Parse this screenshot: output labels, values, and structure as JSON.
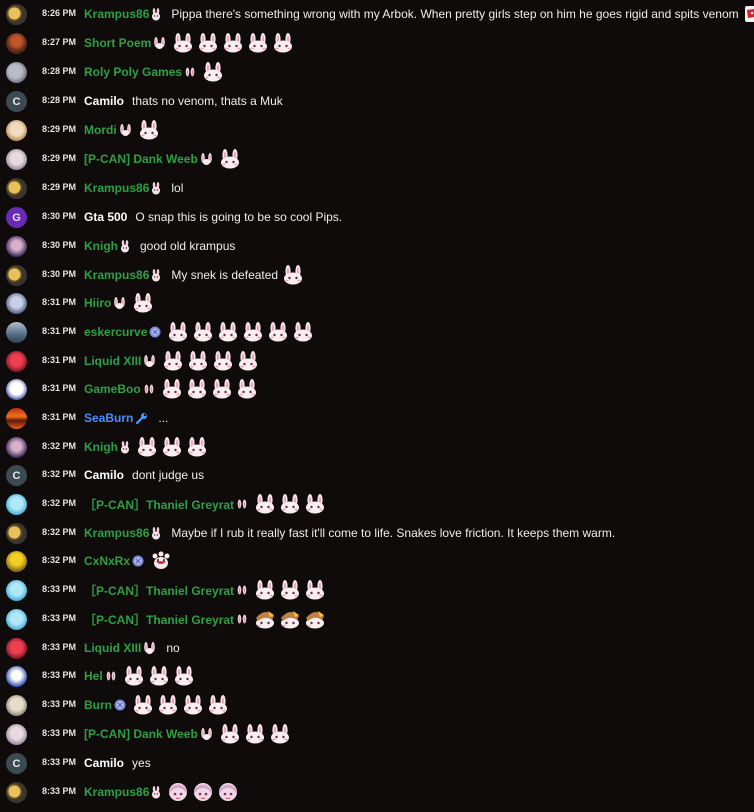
{
  "colors": {
    "background": "#0e0b0a",
    "username_green": "#2ea043",
    "username_white": "#ffffff",
    "username_blue": "#4a8cff",
    "text": "#eeeeee"
  },
  "messages": [
    {
      "time": "8:26 PM",
      "user": "Krampus86",
      "color": "green",
      "avatar": "moon",
      "badge": "bunny-badge",
      "text": "Pippa there's something wrong with my Arbok. When pretty girls step on him he goes rigid and spits venom",
      "emotes": [
        "pippa-emote"
      ]
    },
    {
      "time": "8:27 PM",
      "user": "Short Poem",
      "color": "green",
      "avatar": "photo",
      "badge": "bunny-ears-badge",
      "text": "",
      "emotes": [
        "bunny",
        "bunny",
        "bunny",
        "bunny",
        "bunny"
      ]
    },
    {
      "time": "8:28 PM",
      "user": "Roly Poly Games",
      "color": "green",
      "avatar": "gray",
      "badge": "small-ears-badge",
      "text": "",
      "emotes": [
        "bunny"
      ]
    },
    {
      "time": "8:28 PM",
      "user": "Camilo",
      "color": "white",
      "avatar": "letter",
      "avatar_letter": "C",
      "badge": "",
      "text": "thats no venom, thats a Muk",
      "emotes": []
    },
    {
      "time": "8:29 PM",
      "user": "Mordi",
      "color": "green",
      "avatar": "anime",
      "badge": "bunny-ears-badge",
      "text": "",
      "emotes": [
        "bunny"
      ]
    },
    {
      "time": "8:29 PM",
      "user": "[P-CAN] Dank Weeb",
      "color": "green",
      "avatar": "anime2",
      "badge": "bunny-ears-badge",
      "text": "",
      "emotes": [
        "bunny"
      ]
    },
    {
      "time": "8:29 PM",
      "user": "Krampus86",
      "color": "green",
      "avatar": "moon",
      "badge": "bunny-badge",
      "text": "lol",
      "emotes": []
    },
    {
      "time": "8:30 PM",
      "user": "Gta 500",
      "color": "white",
      "avatar": "letter-purple",
      "avatar_letter": "G",
      "badge": "",
      "text": "O snap this is going to be so cool Pips.",
      "emotes": []
    },
    {
      "time": "8:30 PM",
      "user": "Knigh",
      "color": "green",
      "avatar": "anime3",
      "badge": "bunny-badge",
      "text": "good old krampus",
      "emotes": []
    },
    {
      "time": "8:30 PM",
      "user": "Krampus86",
      "color": "green",
      "avatar": "moon",
      "badge": "bunny-badge",
      "text": "My snek is defeated",
      "emotes": [
        "bunny"
      ]
    },
    {
      "time": "8:31 PM",
      "user": "Hiiro",
      "color": "green",
      "avatar": "anime4",
      "badge": "bunny-ears-badge",
      "text": "",
      "emotes": [
        "bunny"
      ]
    },
    {
      "time": "8:31 PM",
      "user": "eskercurve",
      "color": "green",
      "avatar": "landscape",
      "badge": "prime-badge",
      "text": "",
      "emotes": [
        "bunny",
        "bunny",
        "bunny",
        "bunny",
        "bunny",
        "bunny"
      ]
    },
    {
      "time": "8:31 PM",
      "user": "Liquid XIII",
      "color": "green",
      "avatar": "red",
      "badge": "bunny-ears-badge",
      "text": "",
      "emotes": [
        "bunny",
        "bunny",
        "bunny",
        "bunny"
      ]
    },
    {
      "time": "8:31 PM",
      "user": "GameBoo",
      "color": "green",
      "avatar": "white",
      "badge": "small-ears-badge",
      "text": "",
      "emotes": [
        "bunny",
        "bunny",
        "bunny",
        "bunny"
      ]
    },
    {
      "time": "8:31 PM",
      "user": "SeaBurn",
      "color": "blue",
      "avatar": "sunset",
      "badge": "wrench-badge",
      "text": "...",
      "emotes": []
    },
    {
      "time": "8:32 PM",
      "user": "Knigh",
      "color": "green",
      "avatar": "anime3",
      "badge": "bunny-badge",
      "text": "",
      "emotes": [
        "bunny",
        "bunny",
        "bunny"
      ]
    },
    {
      "time": "8:32 PM",
      "user": "Camilo",
      "color": "white",
      "avatar": "letter",
      "avatar_letter": "C",
      "badge": "",
      "text": "dont judge us",
      "emotes": []
    },
    {
      "time": "8:32 PM",
      "user": "［P-CAN］Thaniel Greyrat",
      "color": "green",
      "avatar": "cyan",
      "badge": "small-ears-badge",
      "text": "",
      "emotes": [
        "bunny",
        "bunny",
        "bunny"
      ]
    },
    {
      "time": "8:32 PM",
      "user": "Krampus86",
      "color": "green",
      "avatar": "moon",
      "badge": "bunny-badge",
      "text": "Maybe if I rub it really fast it'll come to life. Snakes love friction. It keeps them warm.",
      "emotes": []
    },
    {
      "time": "8:32 PM",
      "user": "CxNxRx",
      "color": "green",
      "avatar": "yellow",
      "badge": "prime-badge",
      "text": "",
      "emotes": [
        "creature"
      ]
    },
    {
      "time": "8:33 PM",
      "user": "［P-CAN］Thaniel Greyrat",
      "color": "green",
      "avatar": "cyan",
      "badge": "small-ears-badge",
      "text": "",
      "emotes": [
        "bunny",
        "bunny",
        "bunny"
      ]
    },
    {
      "time": "8:33 PM",
      "user": "［P-CAN］Thaniel Greyrat",
      "color": "green",
      "avatar": "cyan",
      "badge": "small-ears-badge",
      "text": "",
      "emotes": [
        "hat-bunny",
        "hat-bunny",
        "hat-bunny"
      ]
    },
    {
      "time": "8:33 PM",
      "user": "Liquid XIII",
      "color": "green",
      "avatar": "red",
      "badge": "bunny-ears-badge",
      "text": "no",
      "emotes": []
    },
    {
      "time": "8:33 PM",
      "user": "Hel",
      "color": "green",
      "avatar": "blue-white",
      "badge": "small-ears-badge",
      "text": "",
      "emotes": [
        "bunny",
        "bunny",
        "bunny"
      ]
    },
    {
      "time": "8:33 PM",
      "user": "Burn",
      "color": "green",
      "avatar": "beige",
      "badge": "prime-badge",
      "text": "",
      "emotes": [
        "bunny",
        "bunny",
        "bunny",
        "bunny"
      ]
    },
    {
      "time": "8:33 PM",
      "user": "[P-CAN] Dank Weeb",
      "color": "green",
      "avatar": "anime2",
      "badge": "bunny-ears-badge",
      "text": "",
      "emotes": [
        "bunny",
        "bunny",
        "bunny"
      ]
    },
    {
      "time": "8:33 PM",
      "user": "Camilo",
      "color": "white",
      "avatar": "letter",
      "avatar_letter": "C",
      "badge": "",
      "text": "yes",
      "emotes": []
    },
    {
      "time": "8:33 PM",
      "user": "Krampus86",
      "color": "green",
      "avatar": "moon",
      "badge": "bunny-badge",
      "text": "",
      "emotes": [
        "girl",
        "girl",
        "girl"
      ]
    }
  ]
}
